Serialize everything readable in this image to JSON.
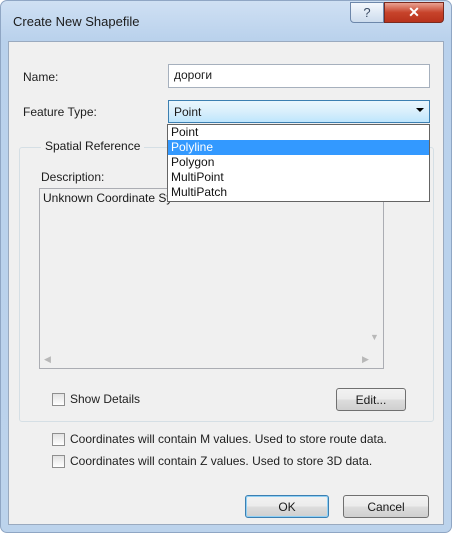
{
  "window": {
    "title": "Create New Shapefile",
    "help_glyph": "?",
    "close_glyph": "✕"
  },
  "form": {
    "name_label": "Name:",
    "name_value": "дороги",
    "feature_type_label": "Feature Type:",
    "feature_type_value": "Point"
  },
  "dropdown": {
    "options": [
      "Point",
      "Polyline",
      "Polygon",
      "MultiPoint",
      "MultiPatch"
    ],
    "highlighted": "Polyline"
  },
  "spatial_reference": {
    "group_label": "Spatial Reference",
    "description_label": "Description:",
    "description_value": "Unknown Coordinate System",
    "show_details_label": "Show Details",
    "edit_button": "Edit..."
  },
  "options": {
    "m_values_label": "Coordinates will contain M values. Used to store route data.",
    "z_values_label": "Coordinates will contain Z values. Used to store 3D data."
  },
  "buttons": {
    "ok": "OK",
    "cancel": "Cancel"
  },
  "colors": {
    "titlebar": "#bcd3ec",
    "close_button": "#c7432b",
    "highlight": "#3399ff"
  }
}
